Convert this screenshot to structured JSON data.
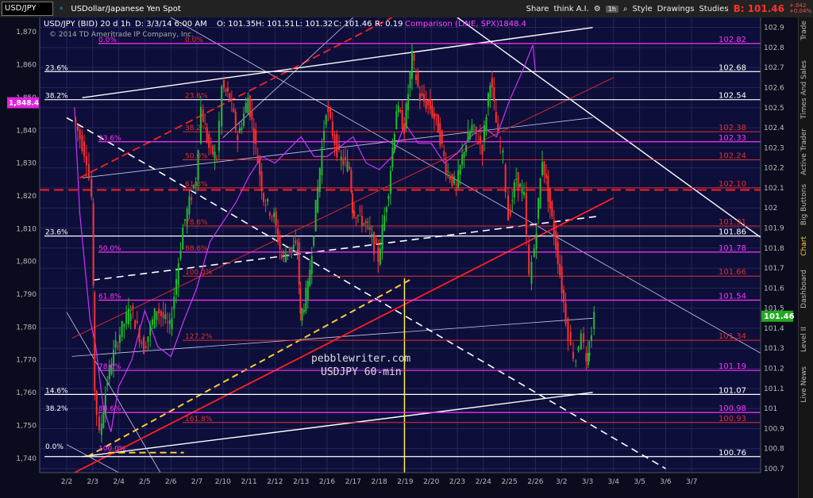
{
  "toolbar": {
    "symbol": "USD/JPY",
    "description": "USDollar/Japanese Yen Spot",
    "share": "Share",
    "think_ai": "think A.I.",
    "interval": "1h",
    "style": "Style",
    "drawings": "Drawings",
    "studies": "Studies",
    "last_price": "B: 101.46",
    "last_change": "+.042 +0.04%"
  },
  "sidebar": {
    "tabs": [
      "Trade",
      "Times And Sales",
      "Active Trader",
      "Big Buttons",
      "Chart",
      "Dashboard",
      "Level II",
      "Live News"
    ]
  },
  "header": {
    "info": "USD/JPY (BID) 20 d 1h",
    "date": "D: 3/3/14 6:00 AM",
    "open": "O: 101.35",
    "high": "H: 101.51",
    "low": "L: 101.32",
    "close": "C: 101.46",
    "range": "R: 0.19",
    "comparison": "Comparison (LINE, SPX)",
    "comparison_value": "1848.4",
    "copyright": "© 2014 TD Ameritrade IP Company, Inc."
  },
  "watermark": {
    "line1": "pebblewriter.com",
    "line2": "USDJPY 60-min"
  },
  "colors": {
    "background": "#0b0b1e",
    "candle_up": "#22bb33",
    "candle_down": "#ff3030",
    "spx_line": "#cc33ff",
    "fib_magenta": "#ff33ff",
    "fib_red": "#e03030",
    "trend_white": "#ffffff",
    "yellow": "#ffee44",
    "price_marker": "#22aa22"
  },
  "chart_data": {
    "type": "candlestick",
    "timeframe": "1h",
    "x_categories": [
      "2/2",
      "2/3",
      "2/4",
      "2/5",
      "2/6",
      "2/7",
      "2/10",
      "2/11",
      "2/12",
      "2/13",
      "2/16",
      "2/17",
      "2/18",
      "2/19",
      "2/20",
      "2/23",
      "2/24",
      "2/25",
      "2/26",
      "3/2",
      "3/3",
      "3/4",
      "3/5",
      "3/6",
      "3/7"
    ],
    "right_axis": {
      "label": "USD/JPY",
      "ylim": [
        100.68,
        102.95
      ],
      "ticks": [
        100.7,
        100.8,
        100.9,
        101.0,
        101.1,
        101.2,
        101.3,
        101.4,
        101.5,
        101.6,
        101.7,
        101.8,
        101.9,
        102.0,
        102.1,
        102.2,
        102.3,
        102.4,
        102.5,
        102.6,
        102.7,
        102.8,
        102.9
      ],
      "tick_labels": [
        "100.7",
        "100.8",
        "100.9",
        "101",
        "101.1",
        "101.2",
        "101.3",
        "101.4",
        "101.5",
        "101.6",
        "101.7",
        "101.8",
        "101.9",
        "102",
        "102.1",
        "102.2",
        "102.3",
        "102.4",
        "102.5",
        "102.6",
        "102.7",
        "102.8",
        "102.9"
      ],
      "current_price": 101.46,
      "current_label": "101.46"
    },
    "left_axis": {
      "label": "SPX comparison",
      "ylim": [
        1735.6,
        1874.4
      ],
      "ticks": [
        1740,
        1750,
        1760,
        1770,
        1780,
        1790,
        1800,
        1810,
        1820,
        1830,
        1840,
        1850,
        1860,
        1870
      ],
      "tick_labels": [
        "1,740",
        "1,750",
        "1,760",
        "1,770",
        "1,780",
        "1,790",
        "1,800",
        "1,810",
        "1,820",
        "1,830",
        "1,840",
        "1,850",
        "1,860",
        "1,870"
      ],
      "marker": 1848.4,
      "marker_label": "1,848.4"
    },
    "series": [
      {
        "name": "USD/JPY",
        "kind": "candles",
        "x": [
          0.3,
          0.8,
          1.0,
          1.1,
          1.3,
          1.6,
          2.0,
          2.5,
          3.0,
          3.5,
          4.0,
          4.5,
          5.0,
          5.2,
          5.5,
          5.8,
          6.0,
          6.3,
          6.6,
          7.0,
          7.3,
          7.6,
          8.0,
          8.3,
          8.6,
          8.9,
          9.0,
          9.3,
          9.6,
          10.0,
          10.5,
          10.9,
          11.0,
          11.3,
          11.6,
          12.0,
          12.4,
          12.7,
          13.0,
          13.3,
          13.6,
          14.0,
          14.3,
          14.6,
          15.0,
          15.3,
          15.6,
          16.0,
          16.3,
          16.6,
          16.8,
          17.0,
          17.3,
          17.6,
          17.8,
          18.0,
          18.3,
          18.6,
          18.9,
          19.2,
          19.4,
          19.6,
          19.8,
          20.0,
          20.1,
          20.3
        ],
        "y": [
          102.45,
          102.25,
          102.05,
          101.1,
          100.86,
          101.15,
          101.35,
          101.5,
          101.3,
          101.5,
          101.4,
          101.9,
          102.15,
          102.5,
          102.3,
          102.25,
          102.6,
          102.55,
          102.35,
          102.55,
          102.3,
          102.05,
          101.95,
          101.75,
          101.8,
          101.8,
          101.45,
          101.6,
          102.0,
          102.5,
          102.25,
          102.2,
          102.0,
          101.95,
          101.9,
          101.75,
          102.1,
          102.5,
          102.4,
          102.75,
          102.55,
          102.5,
          102.4,
          102.2,
          102.1,
          102.3,
          102.4,
          102.3,
          102.65,
          102.35,
          102.25,
          101.95,
          102.15,
          102.05,
          101.65,
          101.8,
          102.25,
          102.0,
          101.75,
          101.45,
          101.3,
          101.25,
          101.4,
          101.2,
          101.3,
          101.46
        ]
      },
      {
        "name": "SPX",
        "kind": "line",
        "x": [
          0.3,
          0.5,
          0.9,
          1.1,
          1.4,
          1.7,
          2.0,
          2.2,
          2.5,
          3.0,
          3.5,
          4.0,
          4.5,
          5.0,
          5.5,
          6.0,
          6.5,
          7.0,
          7.5,
          8.0,
          8.5,
          9.0,
          9.5,
          10.0,
          10.5,
          11.0,
          11.5,
          12.0,
          12.5,
          13.0,
          13.5,
          14.0,
          14.5,
          15.0,
          15.5,
          16.0,
          16.5,
          17.0,
          17.5,
          17.9,
          18.0
        ],
        "y": [
          1847,
          1815,
          1782,
          1775,
          1756,
          1748,
          1762,
          1765,
          1770,
          1785,
          1774,
          1771,
          1782,
          1792,
          1806,
          1812,
          1818,
          1826,
          1832,
          1830,
          1834,
          1838,
          1832,
          1832,
          1835,
          1838,
          1830,
          1828,
          1832,
          1842,
          1836,
          1836,
          1830,
          1833,
          1838,
          1841,
          1838,
          1849,
          1858,
          1866,
          1858
        ]
      }
    ],
    "usd_levels": [
      {
        "label": "102.82",
        "value": 102.82,
        "color": "magenta"
      },
      {
        "label": "102.68",
        "value": 102.68,
        "color": "white"
      },
      {
        "label": "102.54",
        "value": 102.54,
        "color": "white"
      },
      {
        "label": "102.38",
        "value": 102.38,
        "color": "red"
      },
      {
        "label": "102.33",
        "value": 102.33,
        "color": "magenta"
      },
      {
        "label": "102.24",
        "value": 102.24,
        "color": "red"
      },
      {
        "label": "102.10",
        "value": 102.1,
        "color": "red"
      },
      {
        "label": "101.91",
        "value": 101.91,
        "color": "red"
      },
      {
        "label": "101.86",
        "value": 101.86,
        "color": "white"
      },
      {
        "label": "101.78",
        "value": 101.78,
        "color": "magenta"
      },
      {
        "label": "101.66",
        "value": 101.66,
        "color": "red"
      },
      {
        "label": "101.54",
        "value": 101.54,
        "color": "magenta"
      },
      {
        "label": "101.34",
        "value": 101.34,
        "color": "red"
      },
      {
        "label": "101.19",
        "value": 101.19,
        "color": "magenta"
      },
      {
        "label": "101.07",
        "value": 101.07,
        "color": "white"
      },
      {
        "label": "100.98",
        "value": 100.98,
        "color": "magenta"
      },
      {
        "label": "100.93",
        "value": 100.93,
        "color": "red"
      },
      {
        "label": "100.76",
        "value": 100.76,
        "color": "white"
      }
    ],
    "fib_white": [
      {
        "label": "23.6%",
        "value": 102.68
      },
      {
        "label": "38.2%",
        "value": 102.54
      },
      {
        "label": "23.6%",
        "value": 101.86
      },
      {
        "label": "14.6%",
        "value": 101.07
      },
      {
        "label": "38.2%",
        "value": 100.98
      },
      {
        "label": "0.0%",
        "value": 100.79
      }
    ],
    "fib_magenta": [
      {
        "label": "0.0%",
        "value": 102.82
      },
      {
        "label": "23.6%",
        "value": 102.33
      },
      {
        "label": "50.0%",
        "value": 101.78
      },
      {
        "label": "61.8%",
        "value": 101.54
      },
      {
        "label": "78.6%",
        "value": 101.19
      },
      {
        "label": "88.6%",
        "value": 100.98
      },
      {
        "label": "100.0%",
        "value": 100.78
      }
    ],
    "fib_red": [
      {
        "label": "0.0%",
        "value": 102.82
      },
      {
        "label": "23.6%",
        "value": 102.54
      },
      {
        "label": "38.2%",
        "value": 102.38
      },
      {
        "label": "50.0%",
        "value": 102.24
      },
      {
        "label": "61.8%",
        "value": 102.1
      },
      {
        "label": "78.6%",
        "value": 101.91
      },
      {
        "label": "88.6%",
        "value": 101.78
      },
      {
        "label": "100.0%",
        "value": 101.66
      },
      {
        "label": "127.2%",
        "value": 101.34
      },
      {
        "label": "161.8%",
        "value": 100.93
      }
    ],
    "red_dashed_level": 102.09,
    "yellow_vertical_date": "2/19",
    "trendlines": [
      {
        "style": "white",
        "x": [
          0.6,
          20.2
        ],
        "y": [
          102.55,
          102.9
        ]
      },
      {
        "style": "white",
        "x": [
          0.6,
          20.2
        ],
        "y": [
          100.76,
          101.08
        ]
      },
      {
        "style": "white-thin",
        "x": [
          0.6,
          20.2
        ],
        "y": [
          102.15,
          102.45
        ]
      },
      {
        "style": "white-thin",
        "x": [
          0.2,
          20.2
        ],
        "y": [
          101.26,
          101.45
        ]
      },
      {
        "style": "white-dashed",
        "x": [
          0.0,
          23.0
        ],
        "y": [
          102.45,
          100.7
        ]
      },
      {
        "style": "white-dashed",
        "x": [
          1.0,
          20.5
        ],
        "y": [
          101.64,
          101.96
        ]
      },
      {
        "style": "white",
        "x": [
          15.0,
          27.0
        ],
        "y": [
          102.95,
          101.82
        ]
      },
      {
        "style": "white-thin",
        "x": [
          4.0,
          27.0
        ],
        "y": [
          102.95,
          101.25
        ]
      },
      {
        "style": "white-thin",
        "x": [
          0.0,
          3.6
        ],
        "y": [
          101.48,
          100.68
        ]
      },
      {
        "style": "white-thin",
        "x": [
          0.0,
          2.0
        ],
        "y": [
          100.82,
          100.68
        ]
      },
      {
        "style": "yellow-dashed",
        "x": [
          0.8,
          13.3
        ],
        "y": [
          100.76,
          101.65
        ]
      },
      {
        "style": "red",
        "x": [
          0.3,
          21.0
        ],
        "y": [
          100.68,
          102.05
        ]
      },
      {
        "style": "red-dashed",
        "x": [
          0.5,
          12.5
        ],
        "y": [
          102.15,
          102.95
        ]
      },
      {
        "style": "red-thin",
        "x": [
          0.2,
          21.0
        ],
        "y": [
          101.35,
          102.65
        ]
      },
      {
        "style": "white-thin",
        "x": [
          6.0,
          11.0
        ],
        "y": [
          102.35,
          102.95
        ]
      },
      {
        "style": "yellow-dashed",
        "x": [
          1.6,
          4.5
        ],
        "y": [
          100.78,
          100.78
        ]
      }
    ]
  }
}
